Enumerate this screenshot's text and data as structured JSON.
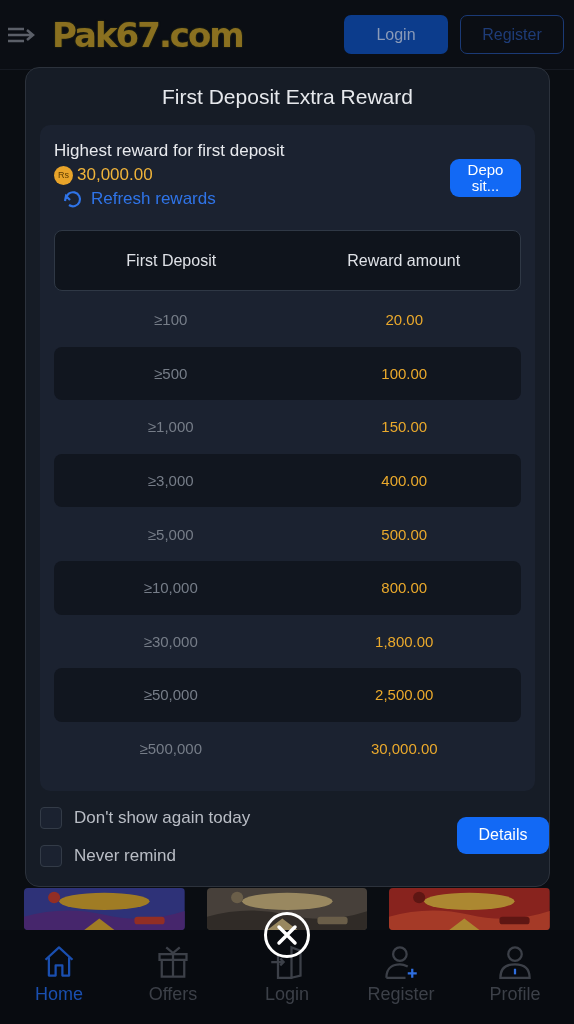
{
  "header": {
    "logo": "Pak67.com",
    "login_button": "Login",
    "register_button": "Register"
  },
  "modal": {
    "title": "First Deposit Extra Reward",
    "highest_label": "Highest reward for first deposit",
    "currency_badge": "Rs",
    "highest_amount": "30,000.00",
    "refresh_link": "Refresh rewards",
    "deposit_button": "Depo sit...",
    "table": {
      "columns": [
        "First Deposit",
        "Reward amount"
      ],
      "rows": [
        {
          "deposit": "≥100",
          "reward": "20.00"
        },
        {
          "deposit": "≥500",
          "reward": "100.00"
        },
        {
          "deposit": "≥1,000",
          "reward": "150.00"
        },
        {
          "deposit": "≥3,000",
          "reward": "400.00"
        },
        {
          "deposit": "≥5,000",
          "reward": "500.00"
        },
        {
          "deposit": "≥10,000",
          "reward": "800.00"
        },
        {
          "deposit": "≥30,000",
          "reward": "1,800.00"
        },
        {
          "deposit": "≥50,000",
          "reward": "2,500.00"
        },
        {
          "deposit": "≥500,000",
          "reward": "30,000.00"
        }
      ]
    },
    "options": [
      {
        "label": "Don't show again today",
        "checked": false
      },
      {
        "label": "Never remind",
        "checked": false
      }
    ],
    "details_button": "Details"
  },
  "bottom_nav": [
    {
      "label": "Home",
      "kind": "home",
      "selected": true
    },
    {
      "label": "Offers",
      "kind": "gift",
      "selected": false
    },
    {
      "label": "Login",
      "kind": "door",
      "selected": false
    },
    {
      "label": "Register",
      "kind": "signup",
      "selected": false
    },
    {
      "label": "Profile",
      "kind": "user",
      "selected": false
    }
  ]
}
